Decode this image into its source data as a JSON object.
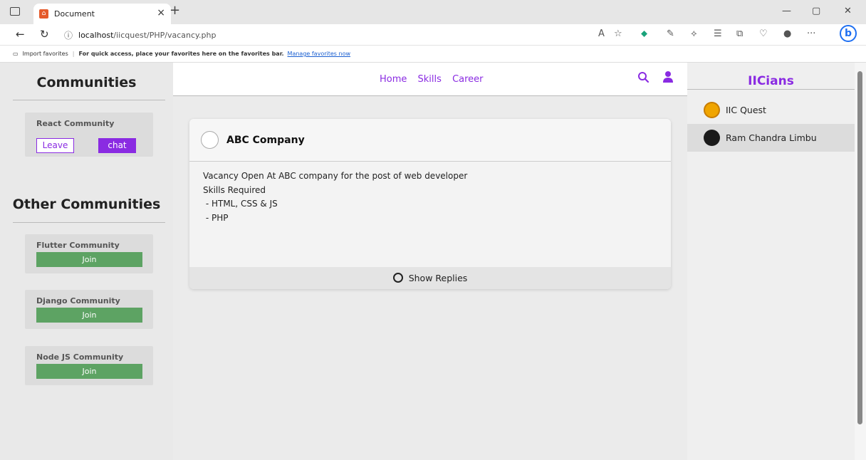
{
  "browser": {
    "tab_title": "Document",
    "url_host": "localhost",
    "url_path": "/iicquest/PHP/vacancy.php",
    "favorites": {
      "import_label": "Import favorites",
      "message": "For quick access, place your favorites here on the favorites bar.",
      "manage_link": "Manage favorites now"
    }
  },
  "left": {
    "title": "Communities",
    "my_communities": [
      {
        "name": "React Community",
        "leave_label": "Leave",
        "chat_label": "chat"
      }
    ],
    "other_title": "Other Communities",
    "other_communities": [
      {
        "name": "Flutter Community",
        "join_label": "Join"
      },
      {
        "name": "Django Community",
        "join_label": "Join"
      },
      {
        "name": "Node JS Community",
        "join_label": "Join"
      }
    ]
  },
  "nav": {
    "links": [
      "Home",
      "Skills",
      "Career"
    ]
  },
  "post": {
    "company": "ABC Company",
    "lines": [
      "Vacancy Open At ABC company for the post of web developer",
      "Skills Required",
      " - HTML, CSS & JS",
      " - PHP"
    ],
    "replies_label": "Show Replies"
  },
  "right": {
    "title": "IICians",
    "users": [
      {
        "name": "IIC Quest",
        "active": false
      },
      {
        "name": "Ram Chandra Limbu",
        "active": true
      }
    ]
  },
  "colors": {
    "accent": "#8a2be2",
    "join": "#5da363"
  }
}
